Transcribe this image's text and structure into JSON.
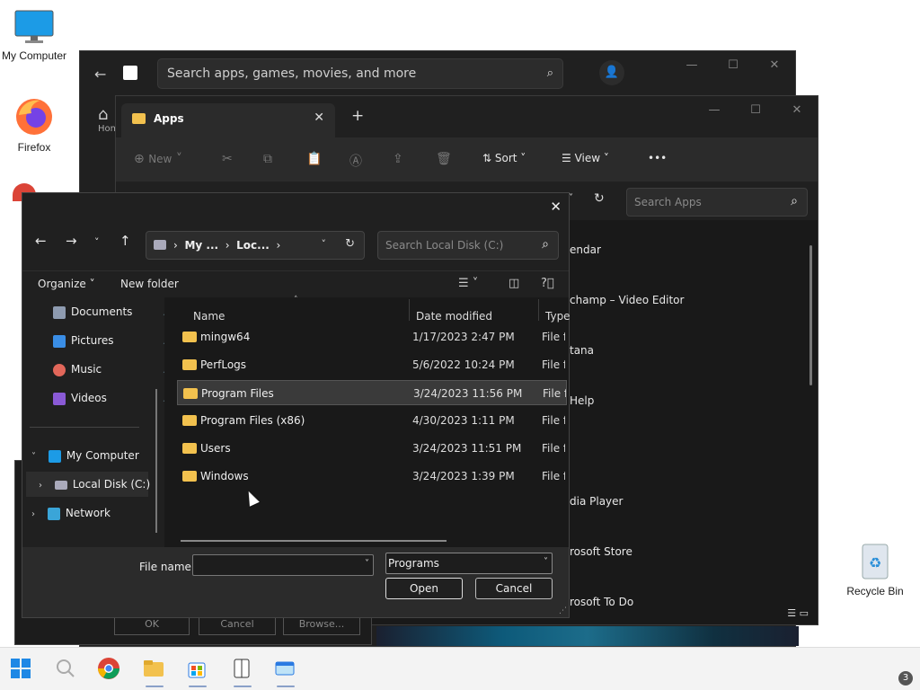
{
  "desktop": {
    "icons": [
      {
        "label": "My Computer"
      },
      {
        "label": "Firefox"
      },
      {
        "label": "Recycle Bin"
      }
    ]
  },
  "store": {
    "search_placeholder": "Search apps, games, movies, and more",
    "side_label": "Hom"
  },
  "explorer": {
    "tab_title": "Apps",
    "toolbar": {
      "new": "New",
      "sort": "Sort",
      "view": "View",
      "more": "•••"
    },
    "search_placeholder": "Search Apps",
    "items": [
      "endar",
      "champ – Video Editor",
      "tana",
      "Help",
      "dia Player",
      "rosoft Store",
      "rosoft To Do"
    ]
  },
  "dialog": {
    "breadcrumb": [
      "My ...",
      "Loc..."
    ],
    "search_placeholder": "Search Local Disk (C:)",
    "commands": {
      "organize": "Organize",
      "new_folder": "New folder"
    },
    "nav": {
      "quick": [
        "Documents",
        "Pictures",
        "Music",
        "Videos"
      ],
      "my_computer": "My Computer",
      "local_disk": "Local Disk (C:)",
      "network": "Network"
    },
    "columns": {
      "name": "Name",
      "date": "Date modified",
      "type": "Type"
    },
    "files": [
      {
        "name": "mingw64",
        "date": "1/17/2023 2:47 PM",
        "type": "File fo"
      },
      {
        "name": "PerfLogs",
        "date": "5/6/2022 10:24 PM",
        "type": "File fo"
      },
      {
        "name": "Program Files",
        "date": "3/24/2023 11:56 PM",
        "type": "File fo"
      },
      {
        "name": "Program Files (x86)",
        "date": "4/30/2023 1:11 PM",
        "type": "File fo"
      },
      {
        "name": "Users",
        "date": "3/24/2023 11:51 PM",
        "type": "File fo"
      },
      {
        "name": "Windows",
        "date": "3/24/2023 1:39 PM",
        "type": "File fo"
      }
    ],
    "filename_label": "File name:",
    "filename_value": "",
    "filetype_value": "Programs",
    "open_label": "Open",
    "cancel_label": "Cancel"
  },
  "under_dialog": {
    "ok": "OK",
    "cancel": "Cancel",
    "browse": "Browse..."
  },
  "taskbar": {
    "notification_count": "3"
  }
}
